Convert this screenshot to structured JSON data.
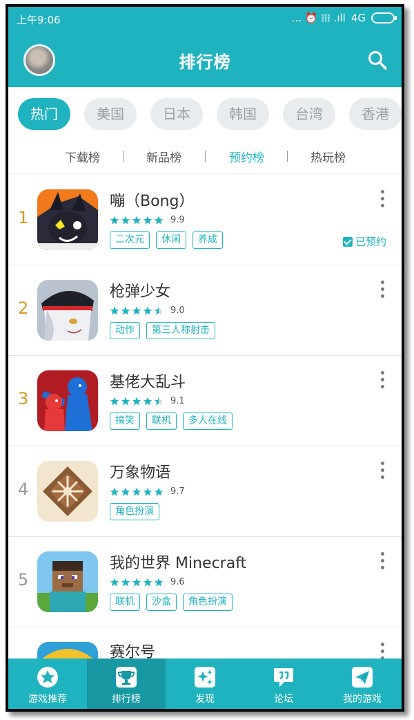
{
  "status_bar": {
    "time": "上午9:06",
    "signal_text": "4G",
    "indicators": "... ⏰ 𝍖 .ıll"
  },
  "header": {
    "title": "排行榜"
  },
  "regions": [
    "热门",
    "美国",
    "日本",
    "韩国",
    "台湾",
    "香港"
  ],
  "active_region": "热门",
  "subtabs": [
    "下载榜",
    "新品榜",
    "预约榜",
    "热玩榜"
  ],
  "active_subtab": "预约榜",
  "games": [
    {
      "rank": "1",
      "name": "嘣（Bong）",
      "rating": 9.9,
      "score_text": "9.9",
      "stars": 5,
      "tags": [
        "二次元",
        "休闲",
        "养成"
      ],
      "reserved_label": "已预约"
    },
    {
      "rank": "2",
      "name": "枪弹少女",
      "rating": 9.0,
      "score_text": "9.0",
      "stars": 4.5,
      "tags": [
        "动作",
        "第三人称射击"
      ]
    },
    {
      "rank": "3",
      "name": "基佬大乱斗",
      "rating": 9.1,
      "score_text": "9.1",
      "stars": 4.5,
      "tags": [
        "搞笑",
        "联机",
        "多人在线"
      ]
    },
    {
      "rank": "4",
      "name": "万象物语",
      "rating": 9.7,
      "score_text": "9.7",
      "stars": 5,
      "tags": [
        "角色扮演"
      ]
    },
    {
      "rank": "5",
      "name": "我的世界 Minecraft",
      "rating": 9.6,
      "score_text": "9.6",
      "stars": 5,
      "tags": [
        "联机",
        "沙盒",
        "角色扮演"
      ]
    },
    {
      "rank": "",
      "name": "赛尔号",
      "partial": true
    }
  ],
  "bottom_nav": [
    {
      "label": "游戏推荐",
      "icon": "star-badge-icon"
    },
    {
      "label": "排行榜",
      "icon": "trophy-icon",
      "active": true
    },
    {
      "label": "发现",
      "icon": "sparkle-icon"
    },
    {
      "label": "论坛",
      "icon": "chat-bubble-icon"
    },
    {
      "label": "我的游戏",
      "icon": "paper-plane-icon"
    }
  ],
  "colors": {
    "accent": "#1fb3bf",
    "accent_dark": "#1798a3",
    "rank_gold": "#d59a2a"
  }
}
